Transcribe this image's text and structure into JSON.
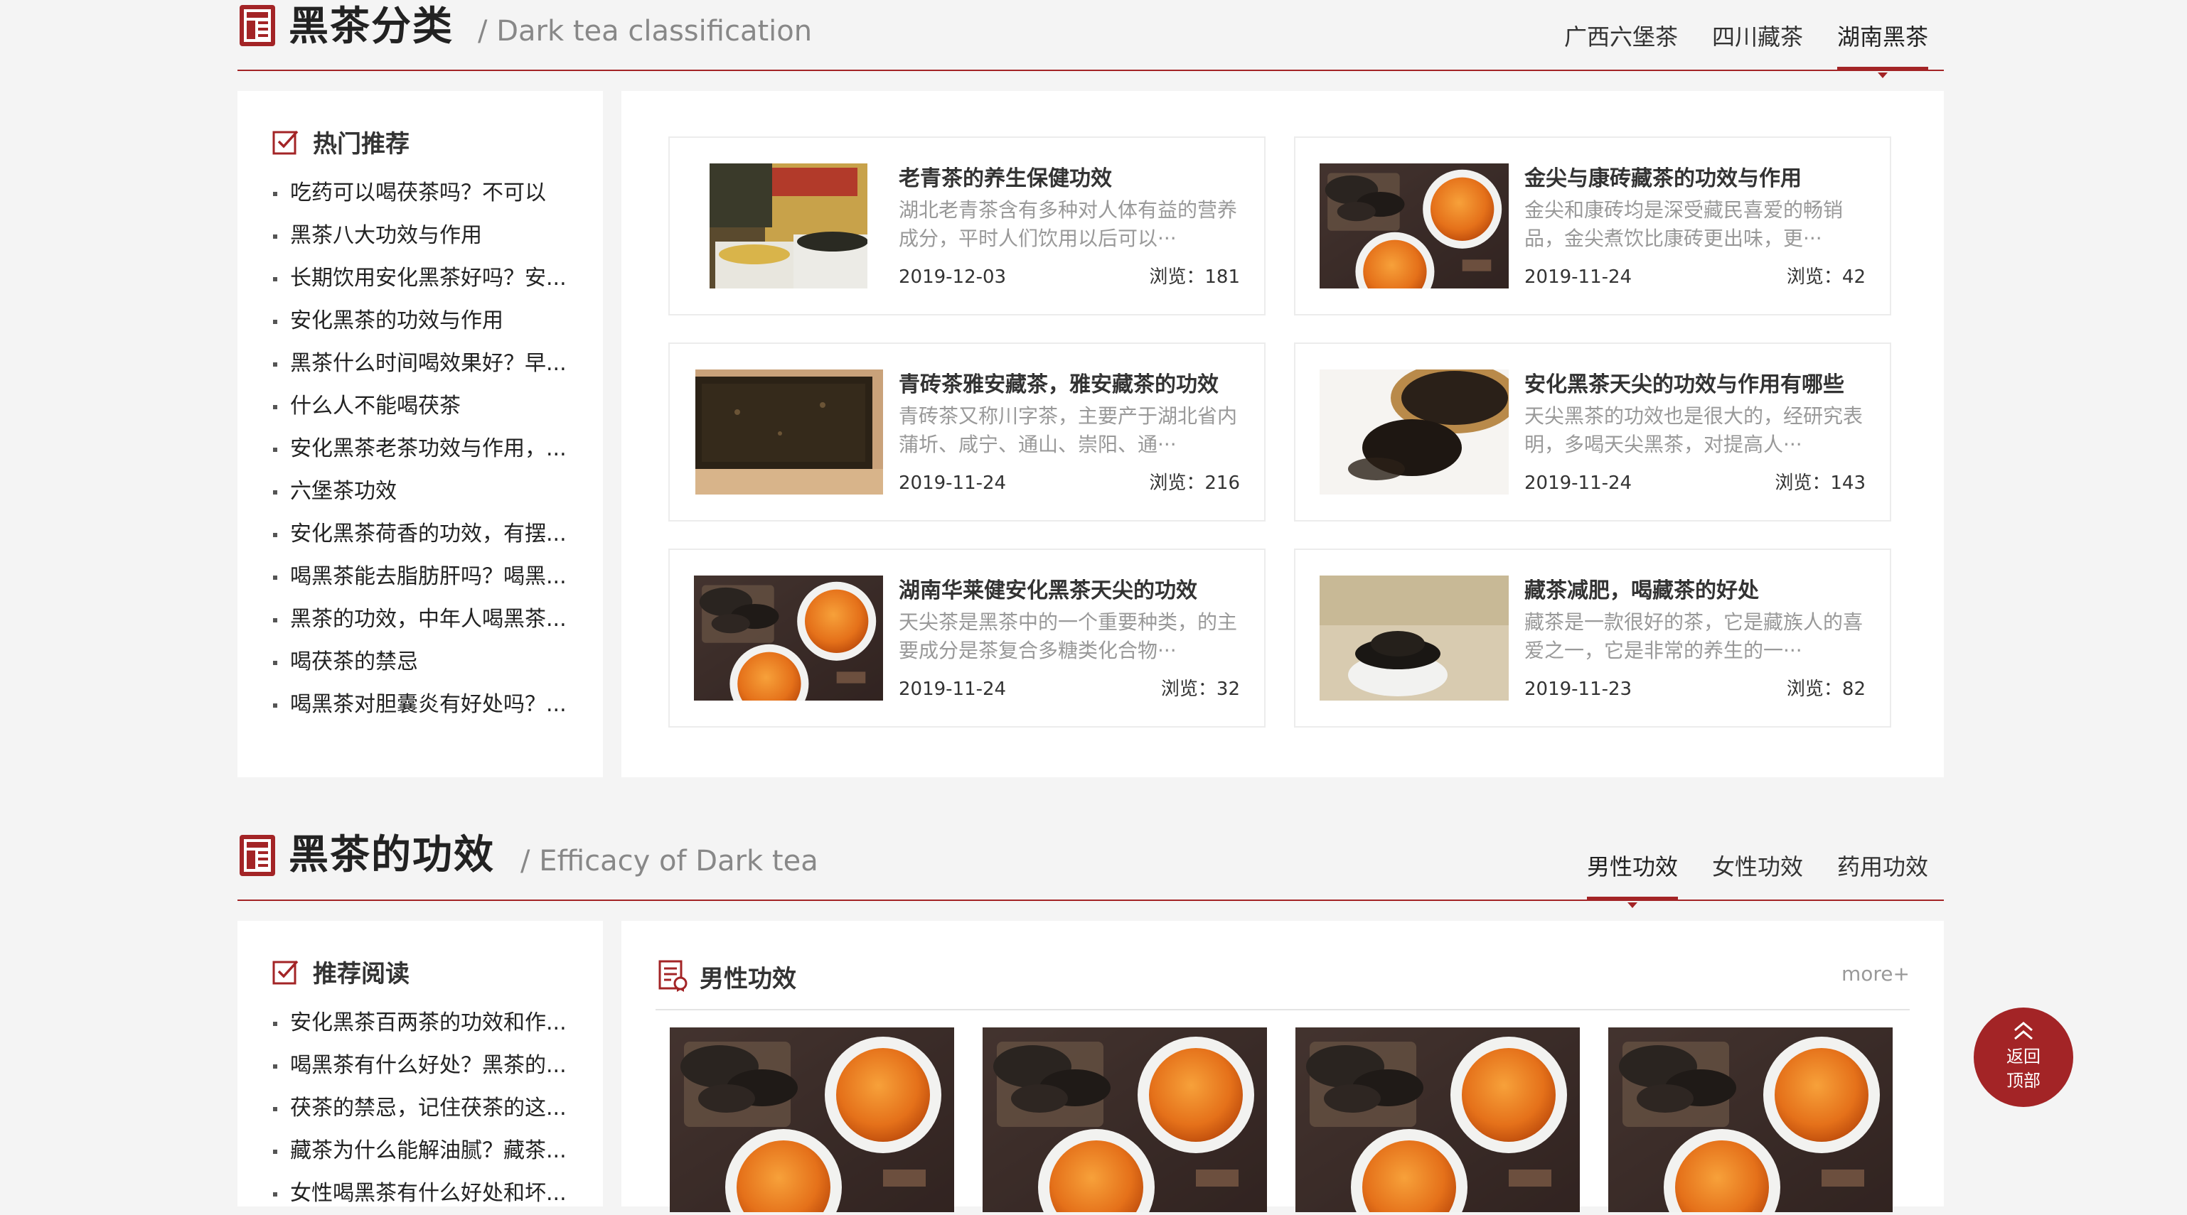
{
  "section1": {
    "title": "黑茶分类",
    "subtitle": "/ Dark tea classification",
    "tabs": [
      "广西六堡茶",
      "四川藏茶",
      "湖南黑茶"
    ],
    "active_tab": "湖南黑茶",
    "sidebar": {
      "title": "热门推荐",
      "items": [
        "吃药可以喝茯茶吗？不可以",
        "黑茶八大功效与作用",
        "长期饮用安化黑茶好吗？安...",
        "安化黑茶的功效与作用",
        "黑茶什么时间喝效果好？早...",
        "什么人不能喝茯茶",
        "安化黑茶老茶功效与作用，...",
        "六堡茶功效",
        "安化黑茶荷香的功效，有摆...",
        "喝黑茶能去脂肪肝吗？喝黑...",
        "黑茶的功效，中年人喝黑茶...",
        "喝茯茶的禁忌",
        "喝黑茶对胆囊炎有好处吗？..."
      ]
    },
    "cards": [
      {
        "title": "老青茶的养生保健功效",
        "desc": "湖北老青茶含有多种对人体有益的营养成分，平时人们饮用以后可以···",
        "date": "2019-12-03",
        "views": "浏览：181",
        "image": "brick-tea-package-photo"
      },
      {
        "title": "金尖与康砖藏茶的功效与作用",
        "desc": "金尖和康砖均是深受藏民喜爱的畅销品，金尖煮饮比康砖更出味，更···",
        "date": "2019-11-24",
        "views": "浏览：42",
        "image": "tea-cups-photo"
      },
      {
        "title": "青砖茶雅安藏茶，雅安藏茶的功效",
        "desc": "青砖茶又称川字茶，主要产于湖北省内蒲圻、咸宁、通山、崇阳、通···",
        "date": "2019-11-24",
        "views": "浏览：216",
        "image": "compressed-brick-photo"
      },
      {
        "title": "安化黑茶天尖的功效与作用有哪些",
        "desc": "天尖黑茶的功效也是很大的，经研究表明，多喝天尖黑茶，对提高人···",
        "date": "2019-11-24",
        "views": "浏览：143",
        "image": "loose-leaf-basket-photo"
      },
      {
        "title": "湖南华莱健安化黑茶天尖的功效",
        "desc": "天尖茶是黑茶中的一个重要种类，的主要成分是茶复合多糖类化合物···",
        "date": "2019-11-24",
        "views": "浏览：32",
        "image": "tea-cups-photo"
      },
      {
        "title": "藏茶减肥，喝藏茶的好处",
        "desc": "藏茶是一款很好的茶，它是藏族人的喜爱之一，它是非常的养生的一···",
        "date": "2019-11-23",
        "views": "浏览：82",
        "image": "dry-leaves-cup-photo"
      }
    ]
  },
  "section2": {
    "title": "黑茶的功效",
    "subtitle": "/ Efficacy of Dark tea",
    "tabs": [
      "男性功效",
      "女性功效",
      "药用功效"
    ],
    "active_tab": "男性功效",
    "sidebar": {
      "title": "推荐阅读",
      "items": [
        "安化黑茶百两茶的功效和作...",
        "喝黑茶有什么好处？黑茶的...",
        "茯茶的禁忌，记住茯茶的这...",
        "藏茶为什么能解油腻？藏茶...",
        "女性喝黑茶有什么好处和坏..."
      ]
    },
    "panel_title": "男性功效",
    "more_label": "more+",
    "tiles": [
      "tea-cups-photo",
      "tea-cups-photo",
      "tea-cups-photo",
      "tea-cups-photo"
    ]
  },
  "back_to_top": {
    "line1": "返回",
    "line2": "顶部"
  },
  "colors": {
    "accent": "#a32426",
    "background": "#f4f4f4"
  }
}
